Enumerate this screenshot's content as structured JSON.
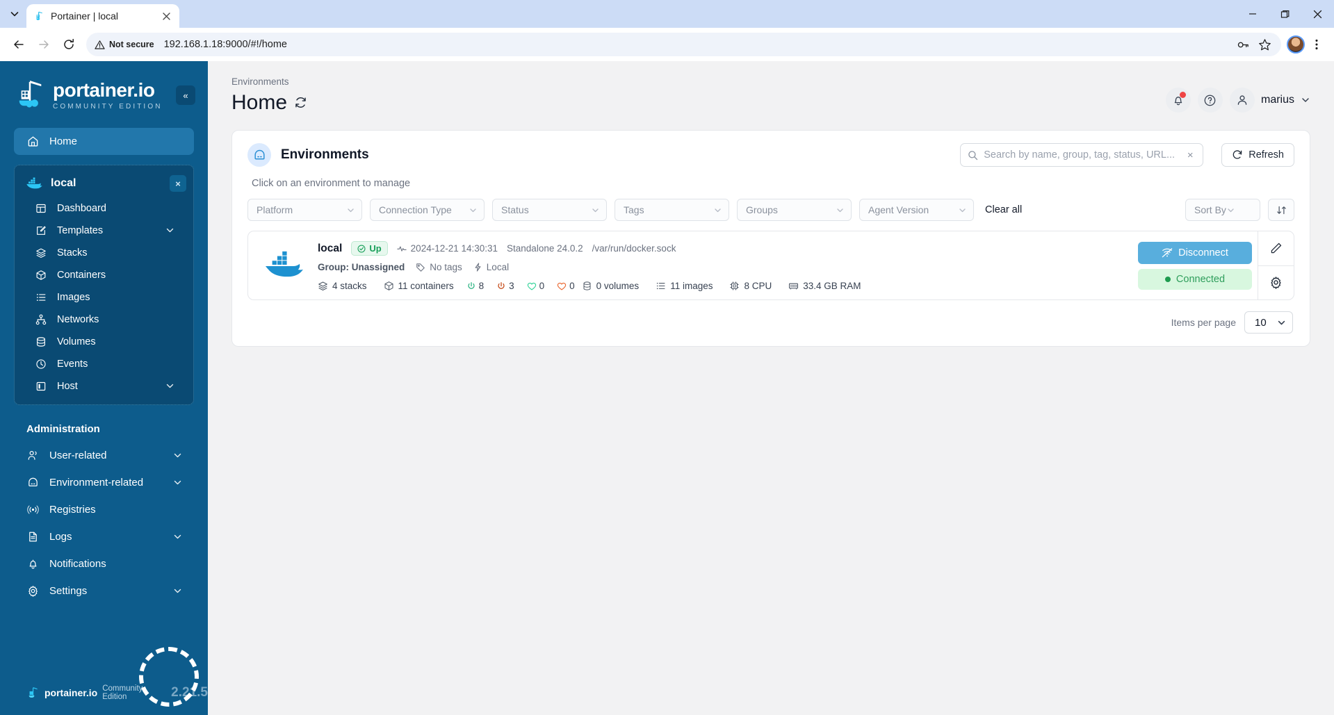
{
  "browser": {
    "tab": {
      "title": "Portainer | local",
      "favicon_icon": "portainer-favicon"
    },
    "tab_list_icon": "chevron-down-icon",
    "close_tab_icon": "close-icon",
    "window_controls": {
      "minimize": "minimize-icon",
      "maximize": "maximize-icon",
      "close": "close-icon"
    },
    "back_icon": "arrow-left-icon",
    "forward_icon": "arrow-right-icon",
    "reload_icon": "reload-icon",
    "security_label": "Not secure",
    "security_icon": "warning-triangle-icon",
    "url": "192.168.1.18:9000/#!/home",
    "password_icon": "key-icon",
    "bookmark_icon": "star-icon",
    "profile_icon": "profile-avatar",
    "menu_icon": "kebab-menu-icon"
  },
  "sidebar": {
    "logo": {
      "name": "portainer.io",
      "subtitle": "COMMUNITY EDITION",
      "icon": "portainer-logo-icon"
    },
    "collapse_icon": "chevron-double-left-icon",
    "collapse_label": "«",
    "home": {
      "label": "Home",
      "icon": "home-icon"
    },
    "environment": {
      "name": "local",
      "icon": "docker-whale-icon",
      "close_label": "×",
      "items": [
        {
          "label": "Dashboard",
          "icon": "dashboard-icon",
          "expandable": false
        },
        {
          "label": "Templates",
          "icon": "template-icon",
          "expandable": true
        },
        {
          "label": "Stacks",
          "icon": "stacks-icon",
          "expandable": false
        },
        {
          "label": "Containers",
          "icon": "container-icon",
          "expandable": false
        },
        {
          "label": "Images",
          "icon": "images-icon",
          "expandable": false
        },
        {
          "label": "Networks",
          "icon": "networks-icon",
          "expandable": false
        },
        {
          "label": "Volumes",
          "icon": "volumes-icon",
          "expandable": false
        },
        {
          "label": "Events",
          "icon": "clock-icon",
          "expandable": false
        },
        {
          "label": "Host",
          "icon": "host-icon",
          "expandable": true
        }
      ]
    },
    "admin_section_title": "Administration",
    "admin_items": [
      {
        "label": "User-related",
        "icon": "users-icon",
        "expandable": true
      },
      {
        "label": "Environment-related",
        "icon": "environment-icon",
        "expandable": true
      },
      {
        "label": "Registries",
        "icon": "registries-icon",
        "expandable": false
      },
      {
        "label": "Logs",
        "icon": "logs-icon",
        "expandable": true
      },
      {
        "label": "Notifications",
        "icon": "bell-icon",
        "expandable": false
      },
      {
        "label": "Settings",
        "icon": "gear-icon",
        "expandable": true
      }
    ],
    "footer": {
      "name": "portainer.io",
      "edition": "Community Edition",
      "version": "2.21.5",
      "icon": "portainer-logo-icon"
    }
  },
  "header": {
    "breadcrumb": "Environments",
    "title": "Home",
    "refresh_icon": "refresh-icon",
    "notifications_icon": "bell-icon",
    "help_icon": "help-circle-icon",
    "user_icon": "user-icon",
    "user_name": "marius",
    "user_chevron_icon": "chevron-down-icon"
  },
  "panel": {
    "icon": "environment-icon",
    "title": "Environments",
    "hint": "Click on an environment to manage",
    "search": {
      "placeholder": "Search by name, group, tag, status, URL...",
      "value": "",
      "icon": "search-icon",
      "clear_label": "×"
    },
    "refresh_button": {
      "label": "Refresh",
      "icon": "refresh-icon"
    },
    "filters": [
      {
        "label": "Platform",
        "name": "platform"
      },
      {
        "label": "Connection Type",
        "name": "connection-type"
      },
      {
        "label": "Status",
        "name": "status"
      },
      {
        "label": "Tags",
        "name": "tags"
      },
      {
        "label": "Groups",
        "name": "groups"
      },
      {
        "label": "Agent Version",
        "name": "agent-version"
      }
    ],
    "clear_all_label": "Clear all",
    "sort_by": {
      "label": "Sort By",
      "direction_icon": "sort-direction-icon"
    },
    "pagination": {
      "label": "Items per page",
      "value": "10"
    }
  },
  "environment_card": {
    "logo_icon": "docker-whale-icon",
    "name": "local",
    "status_badge": {
      "label": "Up",
      "icon": "check-circle-icon"
    },
    "heartbeat_icon": "heartbeat-icon",
    "last_check": "2024-12-21 14:30:31",
    "engine": "Standalone 24.0.2",
    "url": "/var/run/docker.sock",
    "group": "Group: Unassigned",
    "tags": {
      "label": "No tags",
      "icon": "tag-icon"
    },
    "local_label": "Local",
    "local_icon": "bolt-icon",
    "stats": [
      {
        "label": "4 stacks",
        "icon": "stacks-icon",
        "name": "stacks"
      },
      {
        "label": "11 containers",
        "icon": "container-icon",
        "name": "containers"
      },
      {
        "label": "0 volumes",
        "icon": "volumes-icon",
        "name": "volumes"
      },
      {
        "label": "11 images",
        "icon": "images-icon",
        "name": "images"
      },
      {
        "label": "8 CPU",
        "icon": "cpu-icon",
        "name": "cpu"
      },
      {
        "label": "33.4 GB RAM",
        "icon": "ram-icon",
        "name": "ram"
      }
    ],
    "container_states": [
      {
        "value": "8",
        "state": "running",
        "icon": "power-icon",
        "color": "#22b07d"
      },
      {
        "value": "3",
        "state": "stopped",
        "icon": "power-icon",
        "color": "#c2410c"
      },
      {
        "value": "0",
        "state": "healthy",
        "icon": "heart-icon",
        "color": "#34d399"
      },
      {
        "value": "0",
        "state": "unhealthy",
        "icon": "heart-icon",
        "color": "#ea6a33"
      }
    ],
    "disconnect_button": {
      "label": "Disconnect",
      "icon": "disconnect-icon"
    },
    "connected_badge": {
      "label": "Connected"
    },
    "edit_icon": "pencil-icon",
    "settings_icon": "gear-icon"
  },
  "colors": {
    "sidebar_bg": "#0d5c8c",
    "sidebar_active": "#2277ab",
    "sidebar_group_bg": "#0a4a73",
    "accent_blue": "#58aedd",
    "status_green": "#19a05a",
    "status_red": "#ef4444",
    "docker_blue": "#1d91d0"
  }
}
